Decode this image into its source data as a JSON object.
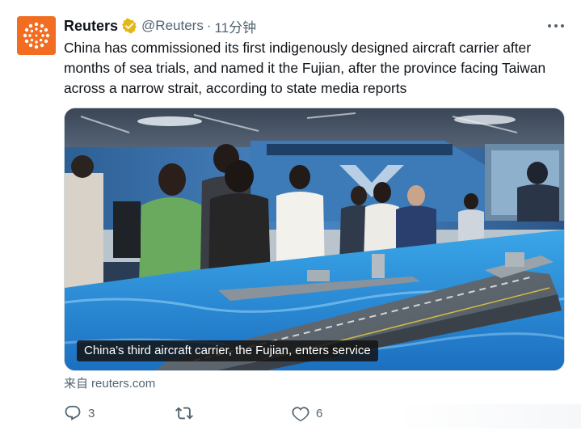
{
  "tweet": {
    "author_name": "Reuters",
    "handle": "@Reuters",
    "separator": "·",
    "time": "11分钟",
    "text": "China has commissioned its first indigenously designed aircraft carrier after months of sea trials, and named it the Fujian, after the province facing Taiwan across a narrow strait, according to state media reports",
    "media": {
      "caption": "China's third aircraft carrier, the Fujian, enters service"
    },
    "source": {
      "label": "来自",
      "domain": "reuters.com"
    }
  },
  "actions": {
    "reply_count": "3",
    "like_count": "6"
  },
  "colors": {
    "avatar_bg": "#f26d21",
    "verified_badge": "#e2b719",
    "secondary_text": "#536471",
    "primary_text": "#0f1419"
  },
  "icons": [
    "reuters-logo-icon",
    "verified-badge-icon",
    "more-options-icon",
    "reply-icon",
    "retweet-icon",
    "like-icon"
  ]
}
